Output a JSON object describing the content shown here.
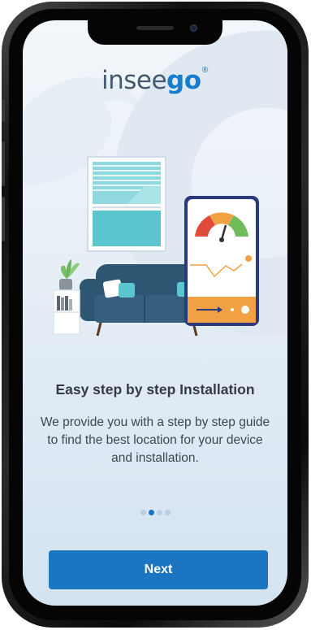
{
  "logo": {
    "part1": "insee",
    "part2": "go",
    "mark": "®"
  },
  "onboarding": {
    "title": "Easy step by step Installation",
    "description": "We provide you with a step by step guide to find the best location for your device and installation."
  },
  "pagination": {
    "total": 4,
    "current": 2
  },
  "next_button": {
    "label": "Next"
  },
  "colors": {
    "accent": "#1b75c0",
    "teal": "#4fc3cf",
    "navy": "#2d5673",
    "orange": "#f2a044"
  },
  "illustration": {
    "icons": [
      "window-icon",
      "sofa-icon",
      "plant-icon",
      "bookshelf-icon",
      "phone-signal-meter-icon"
    ]
  }
}
